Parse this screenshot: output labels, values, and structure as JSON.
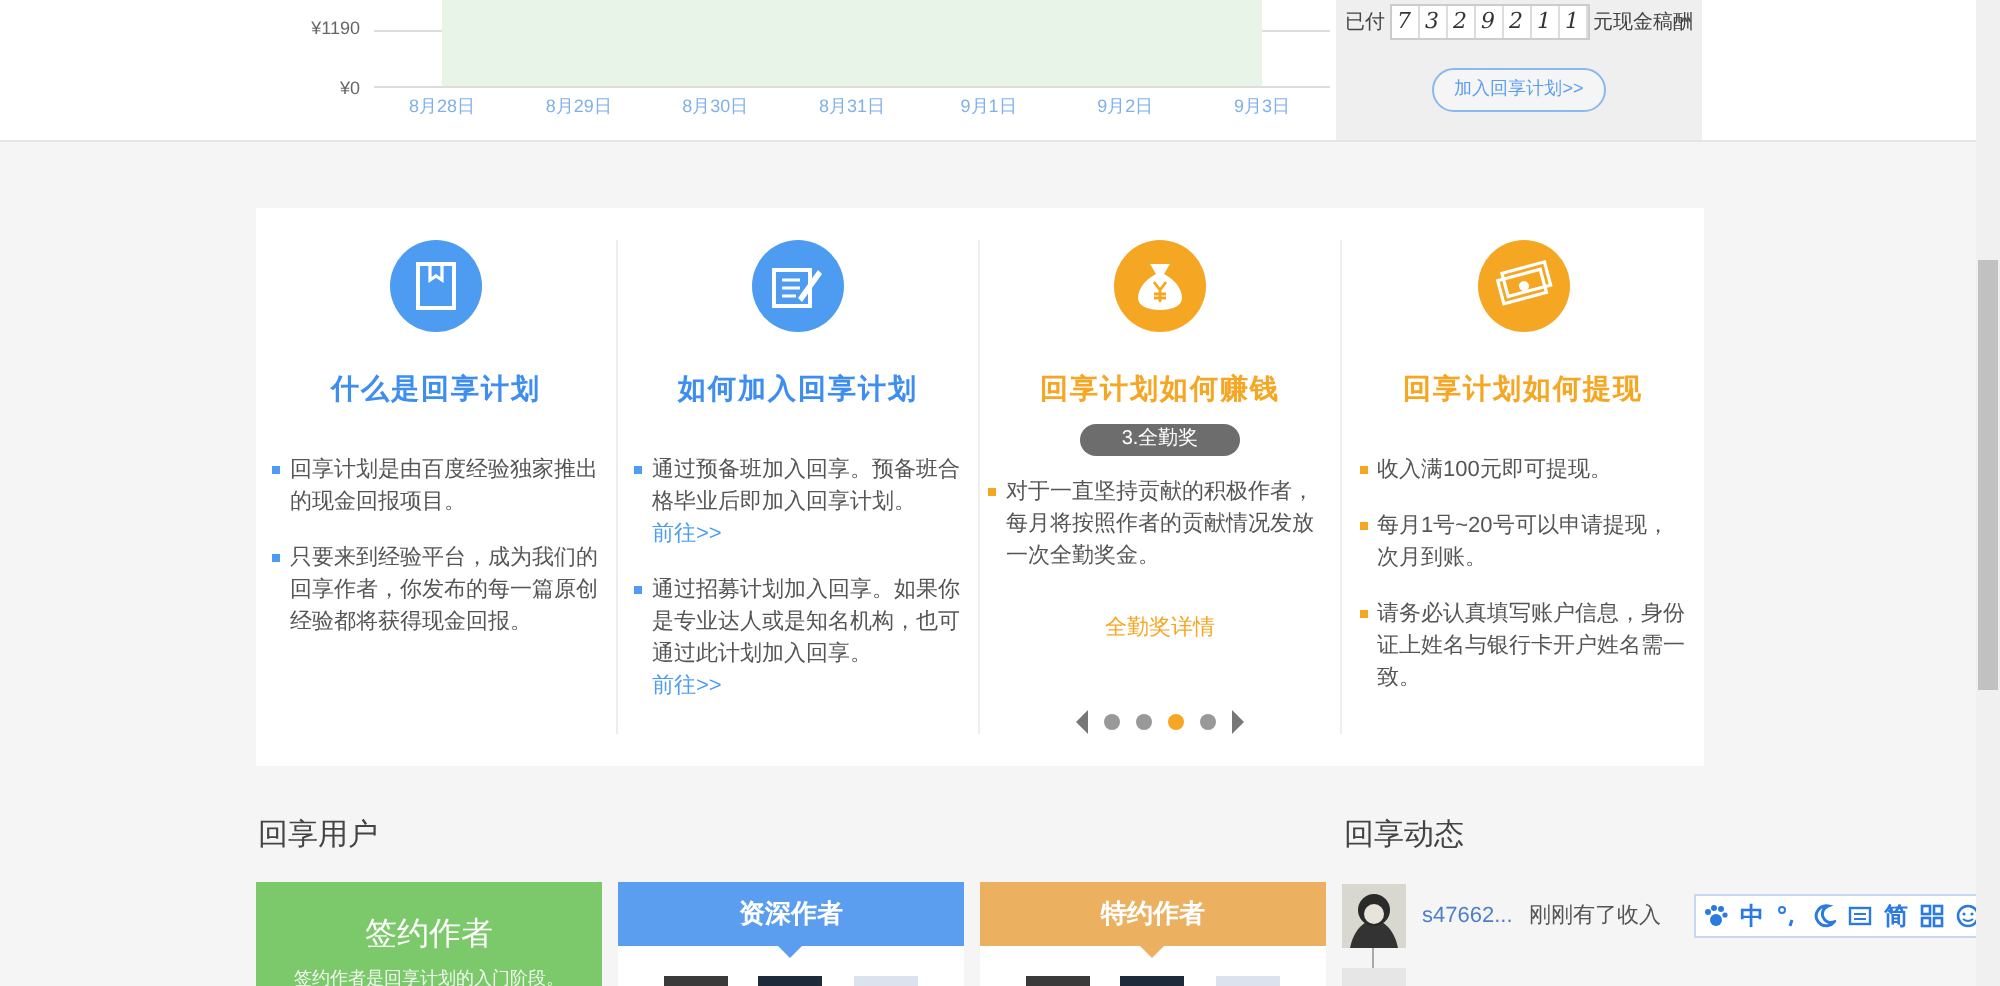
{
  "chart": {
    "y_labels": [
      "¥1190",
      "¥0"
    ],
    "x_labels": [
      "8月28日",
      "8月29日",
      "8月30日",
      "8月31日",
      "9月1日",
      "9月2日",
      "9月3日"
    ]
  },
  "payout": {
    "prefix": "已付",
    "digits": [
      "7",
      "3",
      "2",
      "9",
      "2",
      "1",
      "1"
    ],
    "suffix": "元现金稿酬",
    "button": "加入回享计划>>"
  },
  "features": [
    {
      "title": "什么是回享计划",
      "items": [
        {
          "text": "回享计划是由百度经验独家推出的现金回报项目。"
        },
        {
          "text": "只要来到经验平台，成为我们的回享作者，你发布的每一篇原创经验都将获得现金回报。"
        }
      ]
    },
    {
      "title": "如何加入回享计划",
      "items": [
        {
          "text": "通过预备班加入回享。预备班合格毕业后即加入回享计划。",
          "link": "前往>>"
        },
        {
          "text": "通过招募计划加入回享。如果你是专业达人或是知名机构，也可通过此计划加入回享。",
          "link": "前往>>"
        }
      ]
    },
    {
      "title": "回享计划如何赚钱",
      "badge": "3.全勤奖",
      "items": [
        {
          "text": "对于一直坚持贡献的积极作者，每月将按照作者的贡献情况发放一次全勤奖金。"
        }
      ],
      "detail_link": "全勤奖详情",
      "pager": [
        {
          "selected": false
        },
        {
          "selected": false
        },
        {
          "selected": true
        },
        {
          "selected": false
        }
      ]
    },
    {
      "title": "回享计划如何提现",
      "items": [
        {
          "text": "收入满100元即可提现。"
        },
        {
          "text": "每月1号~20号可以申请提现，次月到账。"
        },
        {
          "text": "请务必认真填写账户信息，身份证上姓名与银行卡开户姓名需一致。"
        }
      ]
    }
  ],
  "users": {
    "heading": "回享用户",
    "cards": [
      {
        "title": "签约作者",
        "color": "#7cc96b",
        "desc": "签约作者是回享计划的入门阶段。"
      },
      {
        "title": "资深作者",
        "color": "#5b9ef0"
      },
      {
        "title": "特约作者",
        "color": "#ebb160"
      }
    ]
  },
  "activity": {
    "heading": "回享动态",
    "entries": [
      {
        "user": "s47662...",
        "text": "刚刚有了收入"
      }
    ]
  },
  "ime": {
    "mode": "中",
    "script": "简"
  }
}
